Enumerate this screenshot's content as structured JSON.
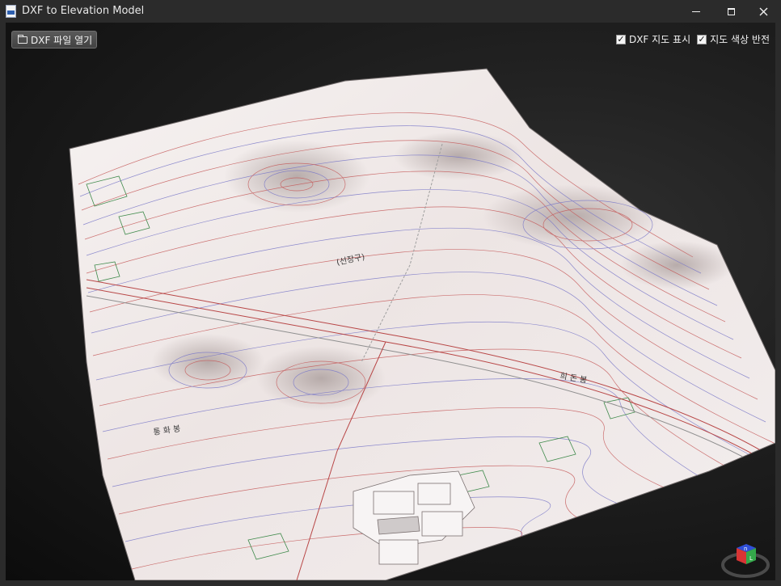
{
  "window": {
    "title": "DXF to Elevation Model",
    "app_icon": "dxf-file-icon",
    "buttons": [
      "minimize-icon",
      "maximize-icon",
      "close-icon"
    ]
  },
  "toolbar": {
    "open_button_label": "DXF 파일 열기",
    "open_button_icon": "folder-open-icon",
    "toggles": [
      {
        "label": "DXF 지도 표시",
        "checked": true
      },
      {
        "label": "지도 색상 반전",
        "checked": true
      }
    ]
  },
  "map": {
    "labels": [
      "(선장구)",
      "희 돈 봉",
      "통 화 봉"
    ]
  },
  "gizmo": {
    "top_face": "n",
    "front_face": "L",
    "colors": {
      "top": "#2f4fd8",
      "front": "#34a84a",
      "side": "#d83434"
    }
  }
}
